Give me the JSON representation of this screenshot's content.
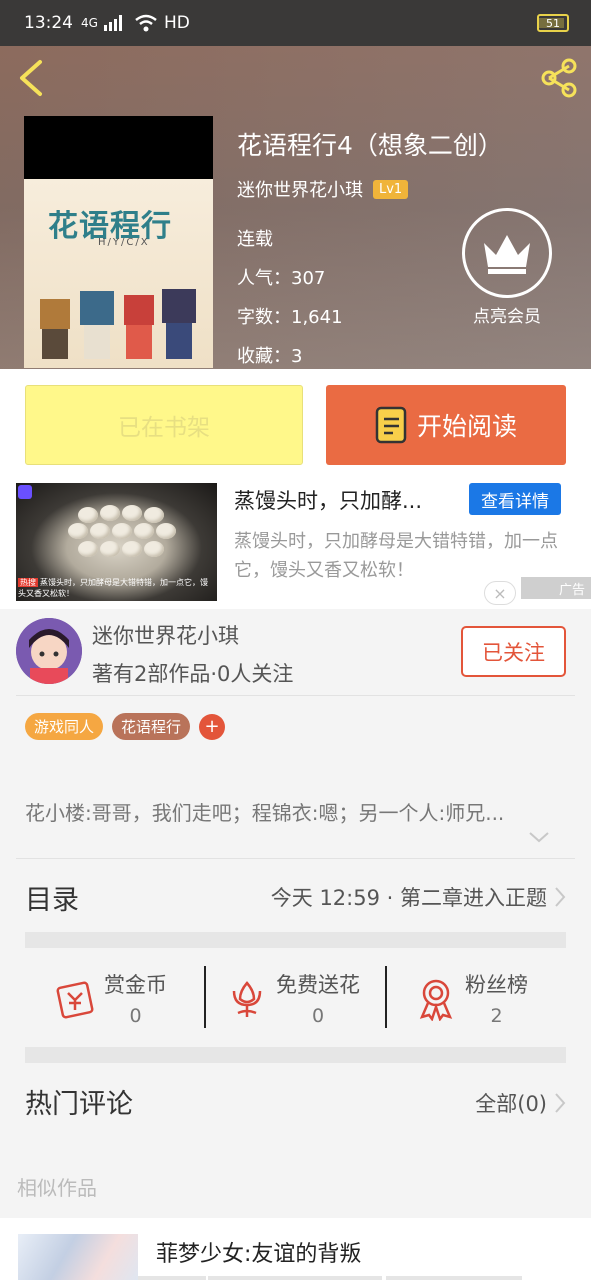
{
  "status_bar": {
    "time": "13:24",
    "signal": "4G",
    "network": "HD",
    "battery": "51"
  },
  "header": {
    "book_title": "花语程行4（想象二创）",
    "author": "迷你世界花小琪",
    "level": "Lv1",
    "status": "连载",
    "popularity": "人气：307",
    "word_count": "字数：1,641",
    "favorites": "收藏：3",
    "vip_label": "点亮会员",
    "cover": {
      "title": "花语程行",
      "subtitle": "H/Y/C/X"
    }
  },
  "actions": {
    "shelf_label": "已在书架",
    "read_label": "开始阅读"
  },
  "ad": {
    "title": "蒸馒头时，只加酵...",
    "detail_label": "查看详情",
    "description": "蒸馒头时，只加酵母是大错特错，加一点它，馒头又香又松软！",
    "caption_tag": "热搜",
    "caption": "蒸馒头时，只加酵母是大错特错，加一点它，馒头又香又松软！",
    "close": "×",
    "ad_tag": "广告"
  },
  "author_card": {
    "name": "迷你世界花小琪",
    "stats": "著有2部作品·0人关注",
    "follow_label": "已关注",
    "tags": [
      "游戏同人",
      "花语程行"
    ],
    "tag_colors": [
      "#f5a742",
      "#b9735a"
    ],
    "add_tag": "+"
  },
  "intro": "花小楼:哥哥，我们走吧；程锦衣:嗯；另一个人:师兄...",
  "toc": {
    "label": "目录",
    "latest": "今天 12:59 · 第二章进入正题"
  },
  "stats": [
    {
      "label": "赏金币",
      "value": "0",
      "icon": "gold-coin-icon"
    },
    {
      "label": "免费送花",
      "value": "0",
      "icon": "flower-icon"
    },
    {
      "label": "粉丝榜",
      "value": "2",
      "icon": "medal-icon"
    }
  ],
  "comments": {
    "label": "热门评论",
    "all": "全部(0)"
  },
  "similar": {
    "section_label": "相似作品",
    "title": "菲梦少女:友谊的背叛"
  },
  "colors": {
    "accent": "#ea6b43",
    "shelf": "#fff88a",
    "link": "#1b78e6",
    "follow": "#e3553a"
  }
}
